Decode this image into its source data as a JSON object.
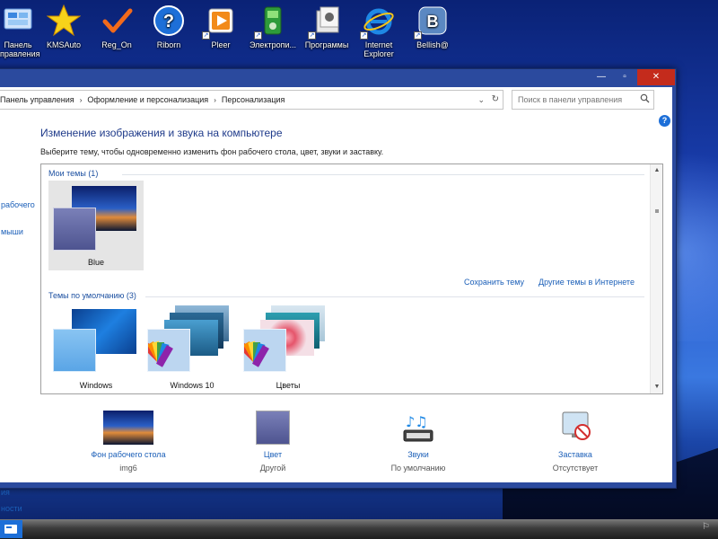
{
  "desktop": {
    "icons": [
      {
        "label_line1": "Панель",
        "label_line2": "управления",
        "icon": "control-panel-icon"
      },
      {
        "label_line1": "KMSAuto",
        "label_line2": "",
        "icon": "star-icon"
      },
      {
        "label_line1": "Reg_On",
        "label_line2": "",
        "icon": "checkmark-icon"
      },
      {
        "label_line1": "Riborn",
        "label_line2": "",
        "icon": "help-icon"
      },
      {
        "label_line1": "Pleer",
        "label_line2": "",
        "icon": "media-player-icon"
      },
      {
        "label_line1": "Электропи...",
        "label_line2": "",
        "icon": "power-icon"
      },
      {
        "label_line1": "Программы",
        "label_line2": "",
        "icon": "programs-icon"
      },
      {
        "label_line1": "Internet",
        "label_line2": "Explorer",
        "icon": "internet-explorer-icon"
      },
      {
        "label_line1": "Bellish@",
        "label_line2": "",
        "icon": "vk-icon"
      }
    ]
  },
  "window": {
    "breadcrumbs": [
      "Панель управления",
      "Оформление и персонализация",
      "Персонализация"
    ],
    "search_placeholder": "Поиск в панели управления",
    "help_glyph": "?",
    "sidebar_partial": [
      "рабочего",
      "мыши",
      "ия",
      "ности"
    ],
    "title": "Изменение изображения и звука на компьютере",
    "description": "Выберите тему, чтобы одновременно изменить фон рабочего стола, цвет, звуки и заставку.",
    "my_themes": {
      "heading": "Мои темы (1)",
      "items": [
        {
          "label": "Blue",
          "selected": true
        }
      ]
    },
    "links": {
      "save_theme": "Сохранить тему",
      "more_online": "Другие темы в Интернете"
    },
    "default_themes": {
      "heading": "Темы по умолчанию (3)",
      "items": [
        {
          "label": "Windows"
        },
        {
          "label": "Windows 10"
        },
        {
          "label": "Цветы"
        }
      ]
    },
    "bottom": [
      {
        "label": "Фон рабочего стола",
        "value": "img6",
        "icon": "wallpaper-icon"
      },
      {
        "label": "Цвет",
        "value": "Другой",
        "icon": "color-swatch-icon"
      },
      {
        "label": "Звуки",
        "value": "По умолчанию",
        "icon": "sound-notes-icon"
      },
      {
        "label": "Заставка",
        "value": "Отсутствует",
        "icon": "screensaver-icon"
      }
    ]
  },
  "colors": {
    "accent": "#1b5fb8",
    "title_blue": "#1e3a8a",
    "window_frame": "#2b4a9e",
    "close_red": "#c42b1c"
  }
}
